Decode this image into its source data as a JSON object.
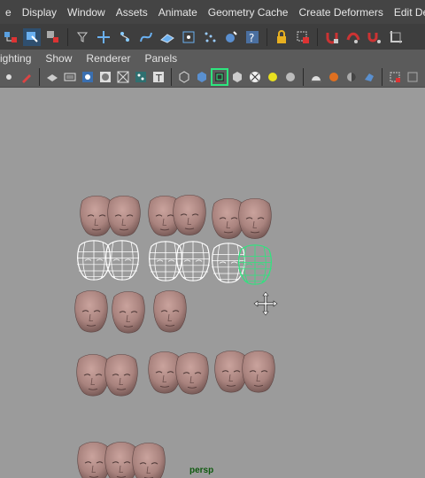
{
  "menubar": {
    "items": [
      "e",
      "Display",
      "Window",
      "Assets",
      "Animate",
      "Geometry Cache",
      "Create Deformers",
      "Edit Deformer"
    ]
  },
  "panelbar": {
    "items": [
      "ighting",
      "Show",
      "Renderer",
      "Panels"
    ]
  },
  "viewport": {
    "camera_label": "persp"
  },
  "colors": {
    "viewport_bg": "#9b9b9b",
    "head_skin": "#b08b86",
    "wire": "#ffffff",
    "selected_wire": "#2ee57e"
  },
  "icons": [
    "move-tool",
    "select-tool",
    "lasso-tool",
    "snap-grid",
    "snap-curve",
    "snap-point",
    "lock",
    "magnet"
  ]
}
